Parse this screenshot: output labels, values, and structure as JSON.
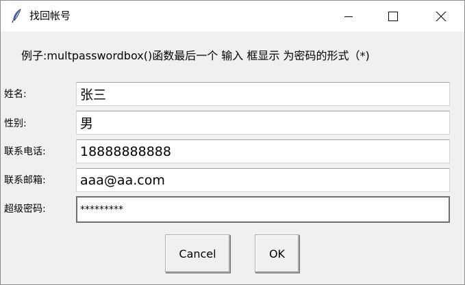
{
  "window": {
    "title": "找回帐号",
    "icon": "feather-icon",
    "controls": [
      "minimize-icon",
      "maximize-icon",
      "close-icon"
    ]
  },
  "prompt": "例子:multpasswordbox()函数最后一个 输入 框显示 为密码的形式（*)",
  "fields": [
    {
      "label": "姓名:",
      "value": "张三"
    },
    {
      "label": "性别:",
      "value": "男"
    },
    {
      "label": "联系电话:",
      "value": "18888888888"
    },
    {
      "label": "联系邮箱:",
      "value": "aaa@aa.com"
    },
    {
      "label": "超级密码:",
      "value": "*********"
    }
  ],
  "buttons": {
    "cancel": "Cancel",
    "ok": "OK"
  }
}
